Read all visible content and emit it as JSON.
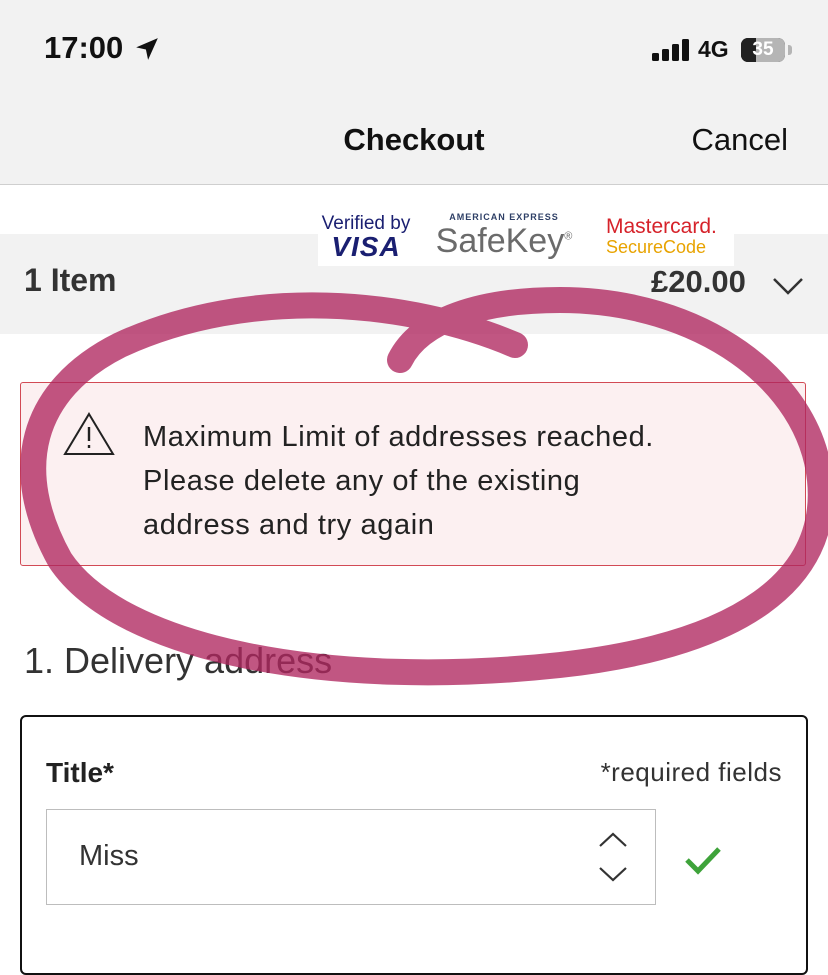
{
  "status_bar": {
    "time": "17:00",
    "network": "4G",
    "battery_percent": "35",
    "icons": [
      "location-arrow-icon",
      "signal-bars-icon",
      "battery-icon"
    ]
  },
  "nav": {
    "title": "Checkout",
    "cancel_label": "Cancel"
  },
  "security_logos": {
    "visa_line1": "Verified by",
    "visa_line2": "VISA",
    "amex_line1": "AMERICAN EXPRESS",
    "amex_line2": "SafeKey",
    "amex_reg": "®",
    "mastercard_line1": "Mastercard.",
    "mastercard_line2": "SecureCode"
  },
  "order_summary": {
    "items_label": "1 Item",
    "total": "£20.00",
    "expand_icon": "chevron-down-icon"
  },
  "alert": {
    "icon": "warning-triangle-icon",
    "lines": [
      "Maximum Limit of addresses reached.",
      "Please delete any of the existing",
      "address and try again"
    ]
  },
  "delivery": {
    "heading": "1. Delivery address",
    "title_label": "Title*",
    "required_note": "*required fields",
    "title_value": "Miss",
    "select_icon": "up-down-chevrons-icon",
    "valid_icon": "green-check-icon"
  },
  "colors": {
    "bar_bg": "#f2f2f2",
    "alert_bg": "#fcf0f1",
    "alert_border": "#d24a55",
    "check_green": "#3ea33a",
    "annotation": "#b0265f"
  }
}
